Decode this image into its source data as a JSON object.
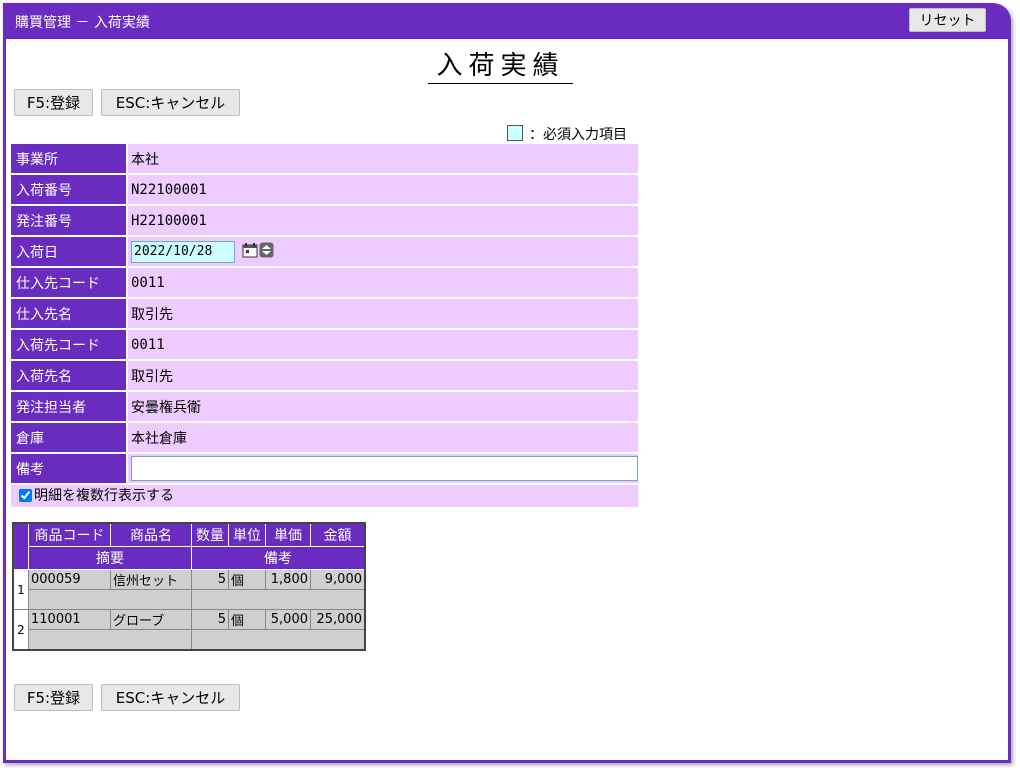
{
  "window": {
    "title": "購買管理 － 入荷実績"
  },
  "toolbar": {
    "reset_label": "リセット",
    "submit_label": "F5:登録",
    "cancel_label": "ESC:キャンセル"
  },
  "page": {
    "title": "入荷実績",
    "required_note": "：必須入力項目"
  },
  "colors": {
    "accent": "#6a2bc0",
    "row_bg": "#eeccff",
    "required": "#ccffff"
  },
  "form": {
    "office_label": "事業所",
    "office": "本社",
    "receipt_no_label": "入荷番号",
    "receipt_no": "N22100001",
    "order_no_label": "発注番号",
    "order_no": "H22100001",
    "receipt_date_label": "入荷日",
    "receipt_date": "2022/10/28",
    "supplier_code_label": "仕入先コード",
    "supplier_code": "0011",
    "supplier_name_label": "仕入先名",
    "supplier_name": "取引先",
    "dest_code_label": "入荷先コード",
    "dest_code": "0011",
    "dest_name_label": "入荷先名",
    "dest_name": "取引先",
    "buyer_label": "発注担当者",
    "buyer": "安曇権兵衛",
    "warehouse_label": "倉庫",
    "warehouse": "本社倉庫",
    "memo_label": "備考",
    "memo": "",
    "multi_row_label": "明細を複数行表示する",
    "multi_row_checked": true
  },
  "detail": {
    "headers": {
      "code": "商品コード",
      "name": "商品名",
      "qty": "数量",
      "unit": "単位",
      "price": "単価",
      "amount": "金額",
      "summary": "摘要",
      "memo": "備考"
    },
    "rows": [
      {
        "no": "1",
        "code": "000059",
        "name": "信州セット",
        "qty": "5",
        "unit": "個",
        "price": "1,800",
        "amount": "9,000",
        "summary": "",
        "memo": ""
      },
      {
        "no": "2",
        "code": "110001",
        "name": "グローブ",
        "qty": "5",
        "unit": "個",
        "price": "5,000",
        "amount": "25,000",
        "summary": "",
        "memo": ""
      }
    ]
  }
}
